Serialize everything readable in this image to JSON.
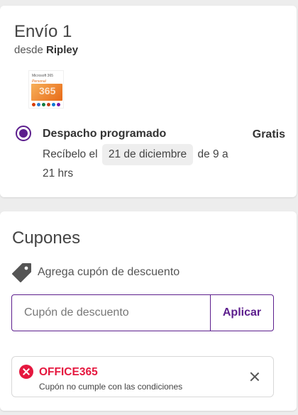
{
  "shipping": {
    "title": "Envío 1",
    "from_prefix": "desde",
    "from_seller": "Ripley",
    "product_image": {
      "brand": "Microsoft 365",
      "edition": "Personal",
      "number": "365"
    },
    "method": {
      "title": "Despacho programado",
      "price": "Gratis",
      "receive_prefix": "Recíbelo el",
      "date": "21 de diciembre",
      "time_part1": "de 9 a",
      "time_part2": "21 hrs"
    }
  },
  "coupons": {
    "title": "Cupones",
    "add_link": "Agrega cupón de descuento",
    "input_placeholder": "Cupón de descuento",
    "apply_label": "Aplicar",
    "error": {
      "code": "OFFICE365",
      "message": "Cupón no cumple con las condiciones"
    }
  },
  "colors": {
    "accent": "#5c1e8d",
    "error": "#e5183f"
  }
}
